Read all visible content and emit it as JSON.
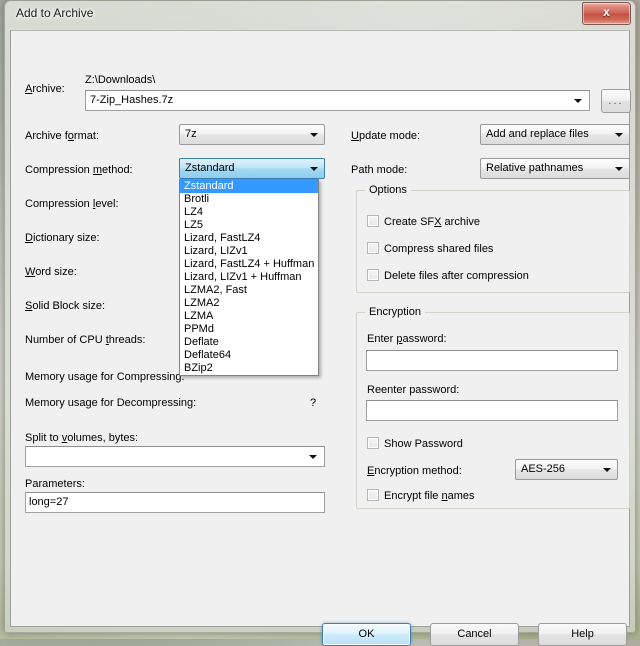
{
  "window": {
    "title": "Add to Archive",
    "close_label": "x"
  },
  "archive": {
    "label": "Archive:",
    "label_pre": "A",
    "label_accel": "r",
    "label_post": "chive:",
    "path_text": "Z:\\Downloads\\",
    "filename_value": "7-Zip_Hashes.7z",
    "browse_label": "..."
  },
  "left": {
    "archive_format_label": "Archive format:",
    "archive_format_value": "7z",
    "compression_method_label": "Compression method:",
    "compression_method_value": "Zstandard",
    "compression_level_label": "Compression level:",
    "dictionary_size_label": "Dictionary size:",
    "word_size_label": "Word size:",
    "solid_block_size_label": "Solid Block size:",
    "cpu_threads_label": "Number of CPU threads:",
    "mem_compress_label": "Memory usage for Compressing:",
    "mem_decompress_label": "Memory usage for Decompressing:",
    "mem_decompress_value": "?",
    "split_label": "Split to volumes, bytes:",
    "split_value": "",
    "parameters_label": "Parameters:",
    "parameters_value": "long=27"
  },
  "compression_method_options": [
    "Zstandard",
    "Brotli",
    "LZ4",
    "LZ5",
    "Lizard, FastLZ4",
    "Lizard, LIZv1",
    "Lizard, FastLZ4 + Huffman",
    "Lizard, LIZv1 + Huffman",
    "LZMA2, Fast",
    "LZMA2",
    "LZMA",
    "PPMd",
    "Deflate",
    "Deflate64",
    "BZip2"
  ],
  "compression_method_selected_index": 0,
  "right": {
    "update_mode_label": "Update mode:",
    "update_mode_value": "Add and replace files",
    "path_mode_label": "Path mode:",
    "path_mode_value": "Relative pathnames",
    "options_group_title": "Options",
    "options": [
      {
        "label": "Create SFX archive",
        "checked": false
      },
      {
        "label": "Compress shared files",
        "checked": false
      },
      {
        "label": "Delete files after compression",
        "checked": false
      }
    ],
    "encryption_group_title": "Encryption",
    "enter_password_label": "Enter password:",
    "enter_password_value": "",
    "reenter_password_label": "Reenter password:",
    "reenter_password_value": "",
    "show_password_label": "Show Password",
    "encryption_method_label": "Encryption method:",
    "encryption_method_value": "AES-256",
    "encrypt_file_names_label": "Encrypt file names"
  },
  "footer": {
    "ok_label": "OK",
    "cancel_label": "Cancel",
    "help_label": "Help"
  },
  "colors": {
    "dialog_face": "#f0f0f0",
    "selection_blue": "#3399ff",
    "focus_blue": "#3c7fb1",
    "close_red": "#c3503f"
  }
}
